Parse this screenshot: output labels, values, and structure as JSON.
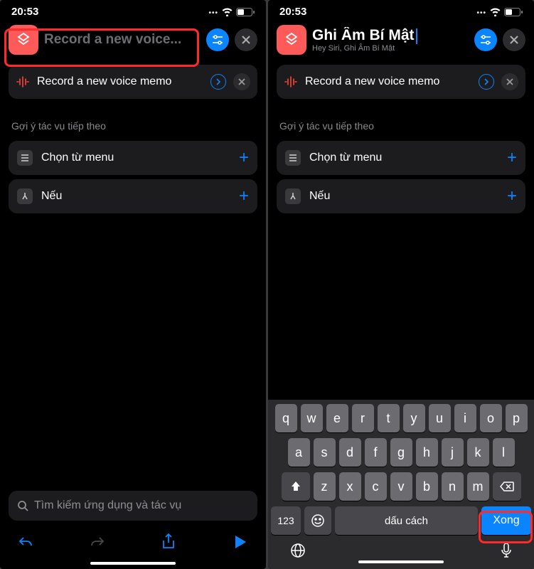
{
  "status": {
    "time": "20:53"
  },
  "left": {
    "title_placeholder": "Record a new voice...",
    "action_label": "Record a new voice memo",
    "section": "Gợi ý tác vụ tiếp theo",
    "suggest1": "Chọn từ menu",
    "suggest2": "Nếu",
    "search_placeholder": "Tìm kiếm ứng dụng và tác vụ"
  },
  "right": {
    "title": "Ghi Âm Bí Mật",
    "subtitle": "Hey Siri, Ghi Âm Bí Mật",
    "action_label": "Record a new voice memo",
    "section": "Gợi ý tác vụ tiếp theo",
    "suggest1": "Chọn từ menu",
    "suggest2": "Nếu"
  },
  "keyboard": {
    "row1": [
      "q",
      "w",
      "e",
      "r",
      "t",
      "y",
      "u",
      "i",
      "o",
      "p"
    ],
    "row2": [
      "a",
      "s",
      "d",
      "f",
      "g",
      "h",
      "j",
      "k",
      "l"
    ],
    "row3": [
      "z",
      "x",
      "c",
      "v",
      "b",
      "n",
      "m"
    ],
    "k123": "123",
    "space": "dấu cách",
    "done": "Xong"
  }
}
